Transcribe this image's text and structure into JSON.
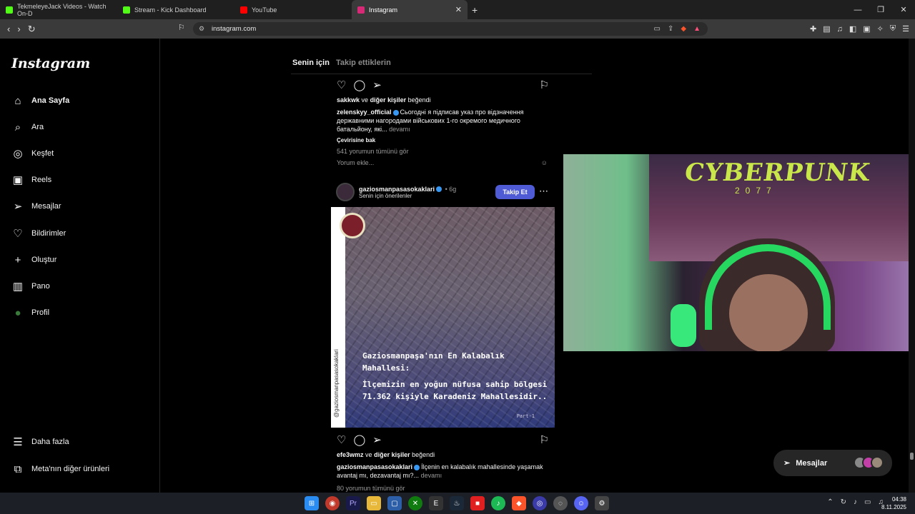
{
  "browser": {
    "tabs": [
      {
        "label": "TekmeleyeJack Videos - Watch On-D",
        "color": "#53fc18"
      },
      {
        "label": "Stream - Kick Dashboard",
        "color": "#53fc18"
      },
      {
        "label": "YouTube",
        "color": "#ff0000"
      },
      {
        "label": "Instagram",
        "color": "#d62976"
      }
    ],
    "url": "instagram.com"
  },
  "sidebar": {
    "logo": "Instagram",
    "items": [
      {
        "label": "Ana Sayfa",
        "icon": "home-icon",
        "glyph": "⌂"
      },
      {
        "label": "Ara",
        "icon": "search-icon",
        "glyph": "⌕"
      },
      {
        "label": "Keşfet",
        "icon": "compass-icon",
        "glyph": "◎"
      },
      {
        "label": "Reels",
        "icon": "reels-icon",
        "glyph": "▣"
      },
      {
        "label": "Mesajlar",
        "icon": "send-icon",
        "glyph": "➢"
      },
      {
        "label": "Bildirimler",
        "icon": "heart-icon",
        "glyph": "♡"
      },
      {
        "label": "Oluştur",
        "icon": "plus-icon",
        "glyph": "+"
      },
      {
        "label": "Pano",
        "icon": "dashboard-icon",
        "glyph": "▥"
      },
      {
        "label": "Profil",
        "icon": "profile-icon",
        "glyph": "●"
      }
    ],
    "more": "Daha fazla",
    "meta": "Meta'nın diğer ürünleri"
  },
  "feed": {
    "tab_for_you": "Senin için",
    "tab_following": "Takip ettiklerin",
    "post1": {
      "likes_user": "sakkwk",
      "likes_rest": "ve",
      "likes_others": "diğer kişiler",
      "likes_suffix": "beğendi",
      "author": "zelenskyy_official",
      "caption": "Сьогодні я підписав указ про відзначення державними нагородами військових 1-го окремого медичного батальйону, які...",
      "more": "devamı",
      "translate": "Çevirisine bak",
      "comments": "541 yorumun tümünü gör",
      "add_comment": "Yorum ekle..."
    },
    "post2": {
      "author": "gaziosmanpasasokaklari",
      "time": "6g",
      "suggested": "Senin için önerilenler",
      "follow": "Takip Et",
      "img_handle": "@gaziosmanpasasokaklari",
      "img_title": "Gaziosmanpaşa'nın En Kalabalık Mahallesi:",
      "img_body": "İlçemizin en yoğun nüfusa sahip bölgesi 71.362 kişiyle Karadeniz Mahallesidir..",
      "img_part": "Part-1",
      "likes_user": "efe3wmz",
      "likes_rest": "ve",
      "likes_others": "diğer kişiler",
      "likes_suffix": "beğendi",
      "caption": "İlçenin en kalabalık mahallesinde yaşamak avantaj mı, dezavantaj mı?...",
      "more": "devamı",
      "comments": "80 yorumun tümünü gör"
    }
  },
  "webcam": {
    "poster_text": "CYBERPUNK",
    "poster_num": "2077"
  },
  "messages_label": "Mesajlar",
  "taskbar": {
    "time": "04:38",
    "date": "8.11.2025"
  }
}
